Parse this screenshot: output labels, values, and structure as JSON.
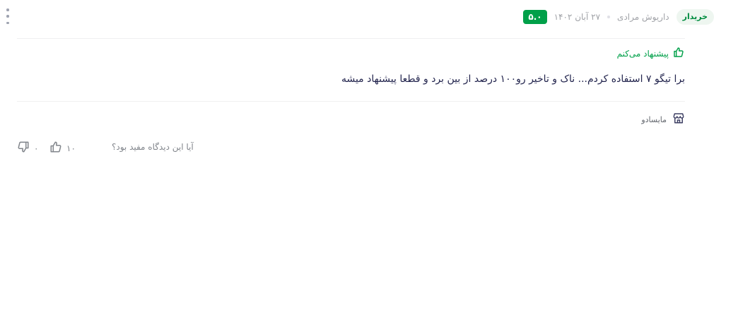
{
  "review": {
    "rating": "۵.۰",
    "buyer_badge": "خریدار",
    "author": "داریوش مرادی",
    "date": "۲۷ آبان ۱۴۰۲",
    "recommendation": "پیشنهاد می‌کنم",
    "text": "برا تیگو ۷ استفاده کردم... ناک و تاخیر رو۱۰۰ درصد از بین برد و قطعا پیشنهاد میشه",
    "seller": "مایسادو"
  },
  "helpful": {
    "question": "آیا این دیدگاه مفید بود؟",
    "likes": "۱۰",
    "dislikes": "۰"
  },
  "colors": {
    "accent_green": "#00a049",
    "badge_bg": "#eef6f0",
    "text_primary": "#23254e",
    "text_muted": "#81858b"
  },
  "icons": [
    "more-vertical-icon",
    "thumb-up-icon",
    "store-icon",
    "thumb-down-icon"
  ]
}
